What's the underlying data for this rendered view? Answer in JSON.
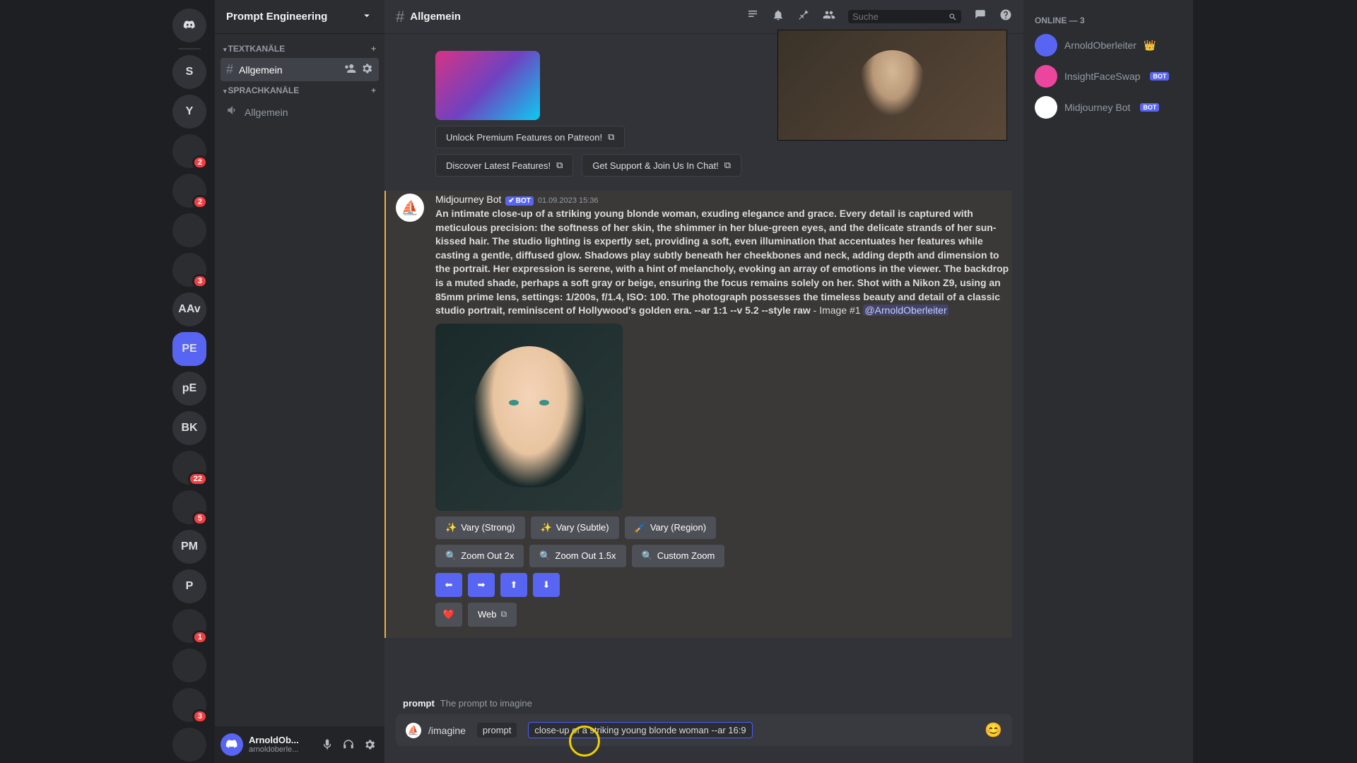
{
  "server_list": {
    "home_selected": false,
    "items": [
      {
        "label": "S",
        "badge": null
      },
      {
        "label": "Y",
        "badge": null
      },
      {
        "label": "",
        "badge": "2",
        "img": true
      },
      {
        "label": "",
        "badge": "2",
        "img": true
      },
      {
        "label": "",
        "badge": null,
        "img": true
      },
      {
        "label": "",
        "badge": "3",
        "img": true
      },
      {
        "label": "AAv",
        "badge": null
      },
      {
        "label": "PE",
        "badge": null,
        "active": true
      },
      {
        "label": "pE",
        "badge": null
      },
      {
        "label": "BK",
        "badge": null
      },
      {
        "label": "",
        "badge": "22",
        "img": true
      },
      {
        "label": "",
        "badge": "5",
        "img": true
      },
      {
        "label": "PM",
        "badge": null
      },
      {
        "label": "P",
        "badge": null
      },
      {
        "label": "",
        "badge": "1",
        "img": true
      },
      {
        "label": "",
        "badge": null,
        "img": true
      },
      {
        "label": "",
        "badge": "3",
        "img": true
      },
      {
        "label": "",
        "badge": null,
        "img": true
      }
    ]
  },
  "server_header": {
    "name": "Prompt Engineering"
  },
  "channels": {
    "text_section": "Textkanäle",
    "voice_section": "Sprachkanäle",
    "text_items": [
      {
        "name": "Allgemein",
        "active": true
      }
    ],
    "voice_items": [
      {
        "name": "Allgemein"
      }
    ]
  },
  "user_panel": {
    "name": "ArnoldOb...",
    "tag": "arnoldoberle..."
  },
  "channel_header": {
    "name": "Allgemein",
    "search_placeholder": "Suche"
  },
  "link_buttons": {
    "patreon": "Unlock Premium Features on Patreon!",
    "discover": "Discover Latest Features!",
    "support": "Get Support & Join Us In Chat!"
  },
  "message": {
    "author": "Midjourney Bot",
    "bot_tag": "BOT",
    "timestamp": "01.09.2023 15:36",
    "prompt_text": "An intimate close-up of a striking young blonde woman, exuding elegance and grace. Every detail is captured with meticulous precision: the softness of her skin, the shimmer in her blue-green eyes, and the delicate strands of her sun-kissed hair. The studio lighting is expertly set, providing a soft, even illumination that accentuates her features while casting a gentle, diffused glow. Shadows play subtly beneath her cheekbones and neck, adding depth and dimension to the portrait. Her expression is serene, with a hint of melancholy, evoking an array of emotions in the viewer. The backdrop is a muted shade, perhaps a soft gray or beige, ensuring the focus remains solely on her. Shot with a Nikon Z9, using an 85mm prime lens, settings: 1/200s, f/1.4, ISO: 100. The photograph possesses the timeless beauty and detail of a classic studio portrait, reminiscent of Hollywood's golden era. --ar 1:1 --v 5.2 --style raw",
    "suffix": " - Image #1 ",
    "mention": "@ArnoldOberleiter"
  },
  "buttons": {
    "vary_strong": "Vary (Strong)",
    "vary_subtle": "Vary (Subtle)",
    "vary_region": "Vary (Region)",
    "zoom_2x": "Zoom Out 2x",
    "zoom_15x": "Zoom Out 1.5x",
    "custom_zoom": "Custom Zoom",
    "web": "Web",
    "arrows": {
      "left": "⬅",
      "right": "➡",
      "up": "⬆",
      "down": "⬇"
    },
    "heart": "❤️"
  },
  "slash": {
    "option": "prompt",
    "option_desc": "The prompt to imagine",
    "command": "/imagine",
    "chip_label": "prompt",
    "value": "close-up of a striking young blonde woman --ar 16:9"
  },
  "members": {
    "heading": "Online — 3",
    "list": [
      {
        "name": "ArnoldOberleiter",
        "crown": true
      },
      {
        "name": "InsightFaceSwap",
        "bot": true
      },
      {
        "name": "Midjourney Bot",
        "bot": true
      }
    ]
  }
}
